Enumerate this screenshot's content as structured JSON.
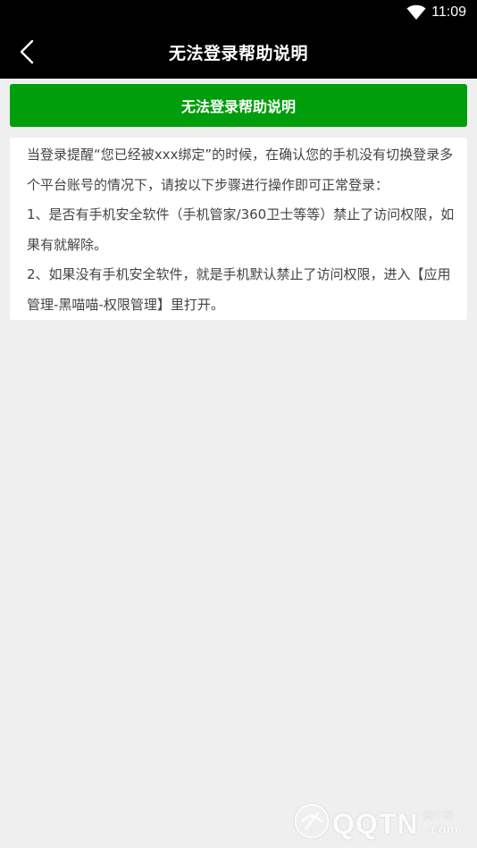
{
  "status_bar": {
    "time": "11:09",
    "wifi_icon": "wifi-icon",
    "background": "#000000"
  },
  "app_bar": {
    "back_icon": "chevron-left-icon",
    "title": "无法登录帮助说明",
    "background": "#000000"
  },
  "help": {
    "header_label": "无法登录帮助说明",
    "header_color": "#009e0b",
    "paragraphs": [
      "当登录提醒“您已经被xxx绑定”的时候，在确认您的手机没有切换登录多个平台账号的情况下，请按以下步骤进行操作即可正常登录：",
      "1、是否有手机安全软件（手机管家/360卫士等等）禁止了访问权限，如果有就解除。",
      "2、如果没有手机安全软件，就是手机默认禁止了访问权限，进入【应用管理-黑喵喵-权限管理】里打开。"
    ]
  },
  "watermark": {
    "logo_icon": "qqtn-logo-icon",
    "text": "QQTN",
    "cn_text": "腾牛网",
    "domain": ".com"
  }
}
